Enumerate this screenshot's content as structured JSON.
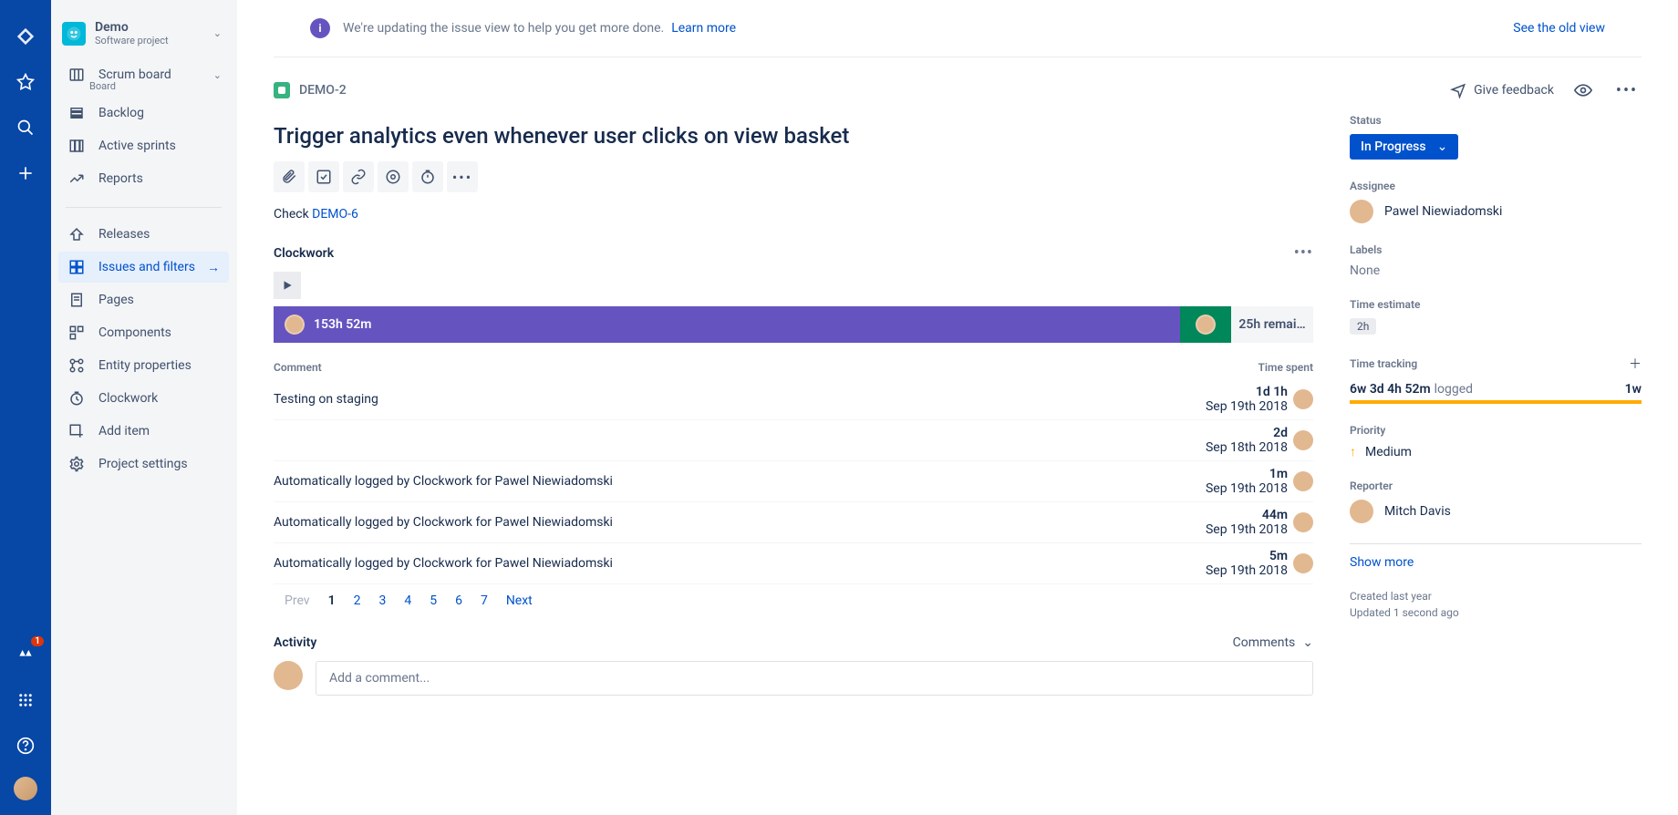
{
  "rail": {
    "notification_count": "1"
  },
  "project": {
    "name": "Demo",
    "type": "Software project"
  },
  "sidebar": {
    "scrum_board": "Scrum board",
    "scrum_board_sub": "Board",
    "items": [
      {
        "label": "Backlog"
      },
      {
        "label": "Active sprints"
      },
      {
        "label": "Reports"
      }
    ],
    "items2": [
      {
        "label": "Releases"
      },
      {
        "label": "Issues and filters"
      },
      {
        "label": "Pages"
      },
      {
        "label": "Components"
      },
      {
        "label": "Entity properties"
      },
      {
        "label": "Clockwork"
      },
      {
        "label": "Add item"
      },
      {
        "label": "Project settings"
      }
    ]
  },
  "banner": {
    "text": "We're updating the issue view to help you get more done.",
    "learn": "Learn more",
    "old_view": "See the old view"
  },
  "issue": {
    "key": "DEMO-2",
    "title": "Trigger analytics even whenever user clicks on view basket",
    "feedback": "Give feedback",
    "desc_prefix": "Check ",
    "desc_link": "DEMO-6"
  },
  "clockwork": {
    "title": "Clockwork",
    "logged": "153h 52m",
    "remaining": "25h remai…",
    "th_comment": "Comment",
    "th_time": "Time spent",
    "rows": [
      {
        "comment": "Testing on staging",
        "time": "1d 1h",
        "date": "Sep 19th 2018"
      },
      {
        "comment": "",
        "time": "2d",
        "date": "Sep 18th 2018"
      },
      {
        "comment": "Automatically logged by Clockwork for Pawel Niewiadomski",
        "time": "1m",
        "date": "Sep 19th 2018"
      },
      {
        "comment": "Automatically logged by Clockwork for Pawel Niewiadomski",
        "time": "44m",
        "date": "Sep 19th 2018"
      },
      {
        "comment": "Automatically logged by Clockwork for Pawel Niewiadomski",
        "time": "5m",
        "date": "Sep 19th 2018"
      }
    ],
    "pager": {
      "prev": "Prev",
      "next": "Next",
      "pages": [
        "1",
        "2",
        "3",
        "4",
        "5",
        "6",
        "7"
      ]
    }
  },
  "activity": {
    "title": "Activity",
    "dropdown": "Comments",
    "placeholder": "Add a comment..."
  },
  "details": {
    "status_label": "Status",
    "status": "In Progress",
    "assignee_label": "Assignee",
    "assignee": "Pawel Niewiadomski",
    "labels_label": "Labels",
    "labels_value": "None",
    "time_estimate_label": "Time estimate",
    "time_estimate": "2h",
    "time_tracking_label": "Time tracking",
    "logged": "6w 3d 4h 52m",
    "logged_suffix": "logged",
    "remaining": "1w",
    "priority_label": "Priority",
    "priority": "Medium",
    "reporter_label": "Reporter",
    "reporter": "Mitch Davis",
    "show_more": "Show more",
    "created": "Created last year",
    "updated": "Updated 1 second ago"
  }
}
